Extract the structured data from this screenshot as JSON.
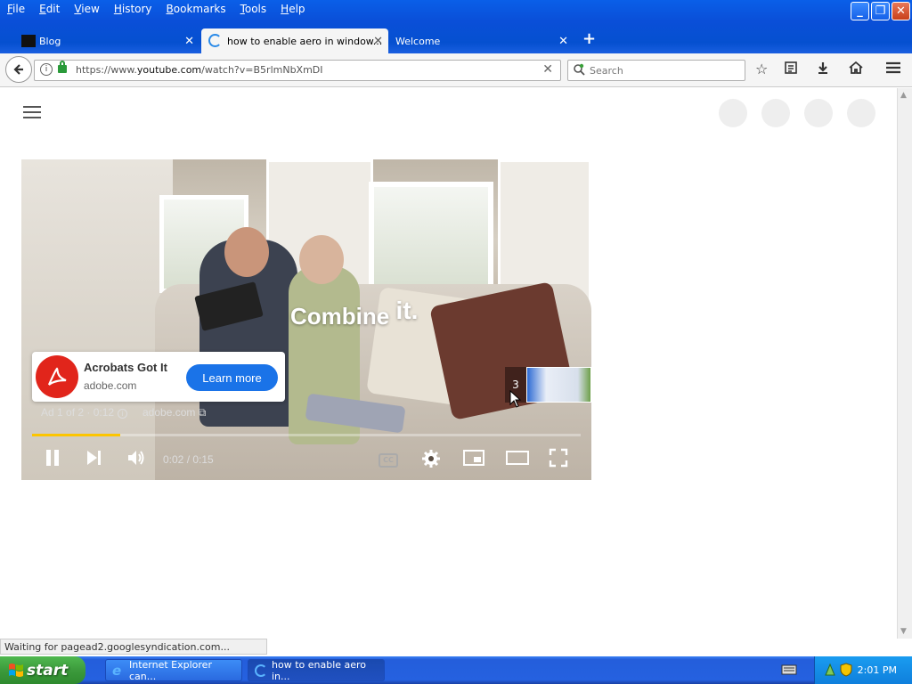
{
  "menu": [
    "File",
    "Edit",
    "View",
    "History",
    "Bookmarks",
    "Tools",
    "Help"
  ],
  "tabs": [
    {
      "title": "Blog"
    },
    {
      "title": "how to enable aero in window..."
    },
    {
      "title": "Welcome"
    }
  ],
  "address": {
    "url_prefix": "https://www.",
    "url_domain": "youtube.com",
    "url_path": "/watch?v=B5rlmNbXmDI"
  },
  "search": {
    "placeholder": "Search"
  },
  "video": {
    "overlay_text_1": "Combine",
    "overlay_text_2": "it.",
    "ad": {
      "name": "Acrobats Got It",
      "domain": "adobe.com",
      "cta": "Learn more",
      "meta": "Ad 1 of 2 · 0:12",
      "meta_domain": "adobe.com"
    },
    "preview_number": "3",
    "progress": 0.16,
    "time": "0:02 / 0:15",
    "cc": "CC"
  },
  "status": "Waiting for pagead2.googlesyndication.com...",
  "taskbar": {
    "start": "start",
    "items": [
      {
        "label": "Internet Explorer can..."
      },
      {
        "label": "how to enable aero in..."
      }
    ],
    "clock": "2:01 PM"
  },
  "colors": {
    "accent": "#1a73e8",
    "progress": "#fcc500",
    "adobe_red": "#e1251b"
  }
}
